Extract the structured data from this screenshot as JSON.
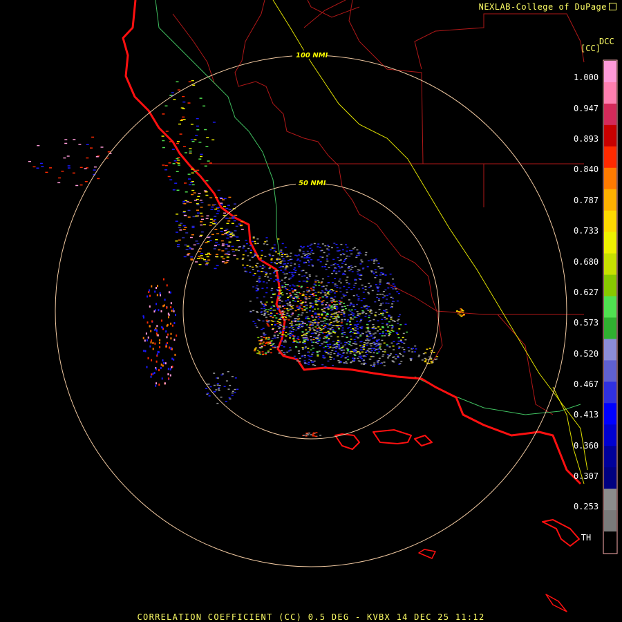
{
  "header": {
    "brand": "NEXLAB-College of DuPage"
  },
  "legend": {
    "product_code": "DCC",
    "unit": "[CC]",
    "labels": [
      "1.000",
      "0.947",
      "0.893",
      "0.840",
      "0.787",
      "0.733",
      "0.680",
      "0.627",
      "0.573",
      "0.520",
      "0.467",
      "0.413",
      "0.360",
      "0.307",
      "0.253",
      "TH"
    ],
    "colors": [
      "#ff9ad8",
      "#ff7fb0",
      "#d42a5a",
      "#c80000",
      "#ff2a00",
      "#ff7a00",
      "#ffb000",
      "#ffd800",
      "#f0f000",
      "#c8e000",
      "#88c800",
      "#50e050",
      "#30b030",
      "#8c8cd8",
      "#6060d0",
      "#3030e0",
      "#0000ff",
      "#0000d0",
      "#00009a",
      "#000080",
      "#8c8c8c",
      "#7a7a7a",
      "#000000"
    ]
  },
  "range_rings": [
    {
      "label": "100 NMI"
    },
    {
      "label": "50 NMI"
    }
  ],
  "footer": {
    "caption": "CORRELATION COEFFICIENT (CC) 0.5 DEG - KVBX 14 DEC 25 11:12"
  },
  "colors": {
    "coast": "#ff1010",
    "boundary": "#b01818",
    "highway": "#e0e000",
    "river": "#40c060",
    "ring": "#f0c8a0"
  }
}
